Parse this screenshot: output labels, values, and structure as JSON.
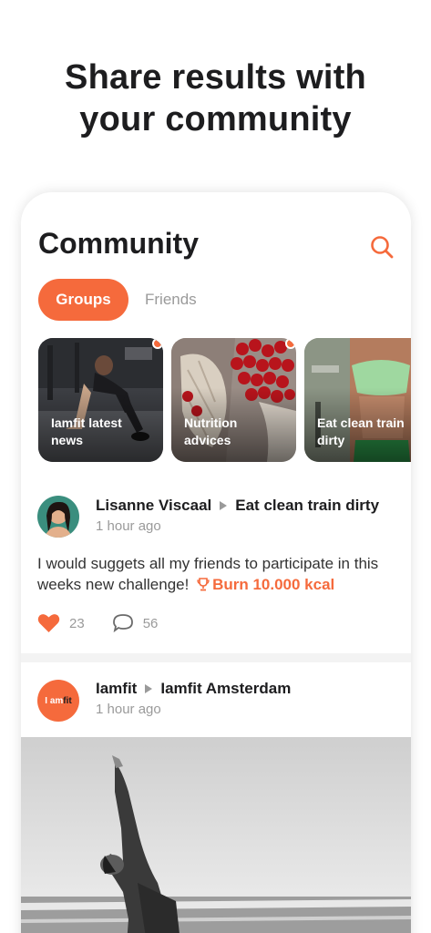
{
  "headline": {
    "line1": "Share results with",
    "line2": "your community"
  },
  "screen": {
    "title": "Community"
  },
  "tabs": {
    "groups": "Groups",
    "friends": "Friends"
  },
  "stories": [
    {
      "label": "Iamfit latest\nnews",
      "new": true
    },
    {
      "label": "Nutrition\nadvices",
      "new": true
    },
    {
      "label": "Eat clean train\ndirty",
      "new": false
    }
  ],
  "post1": {
    "author": "Lisanne Viscaal",
    "group": "Eat clean train dirty",
    "time": "1 hour ago",
    "text": "I would suggets all my friends to participate in this weeks new challenge!",
    "challenge": "Burn 10.000 kcal",
    "likes": "23",
    "comments": "56"
  },
  "post2": {
    "author": "Iamfit",
    "group": "Iamfit Amsterdam",
    "time": "1 hour ago",
    "logo": {
      "prefix": "I am",
      "suffix": "fit"
    }
  },
  "colors": {
    "accent": "#f56a3c",
    "text": "#1d1d1f",
    "muted": "#9a9a9a"
  }
}
